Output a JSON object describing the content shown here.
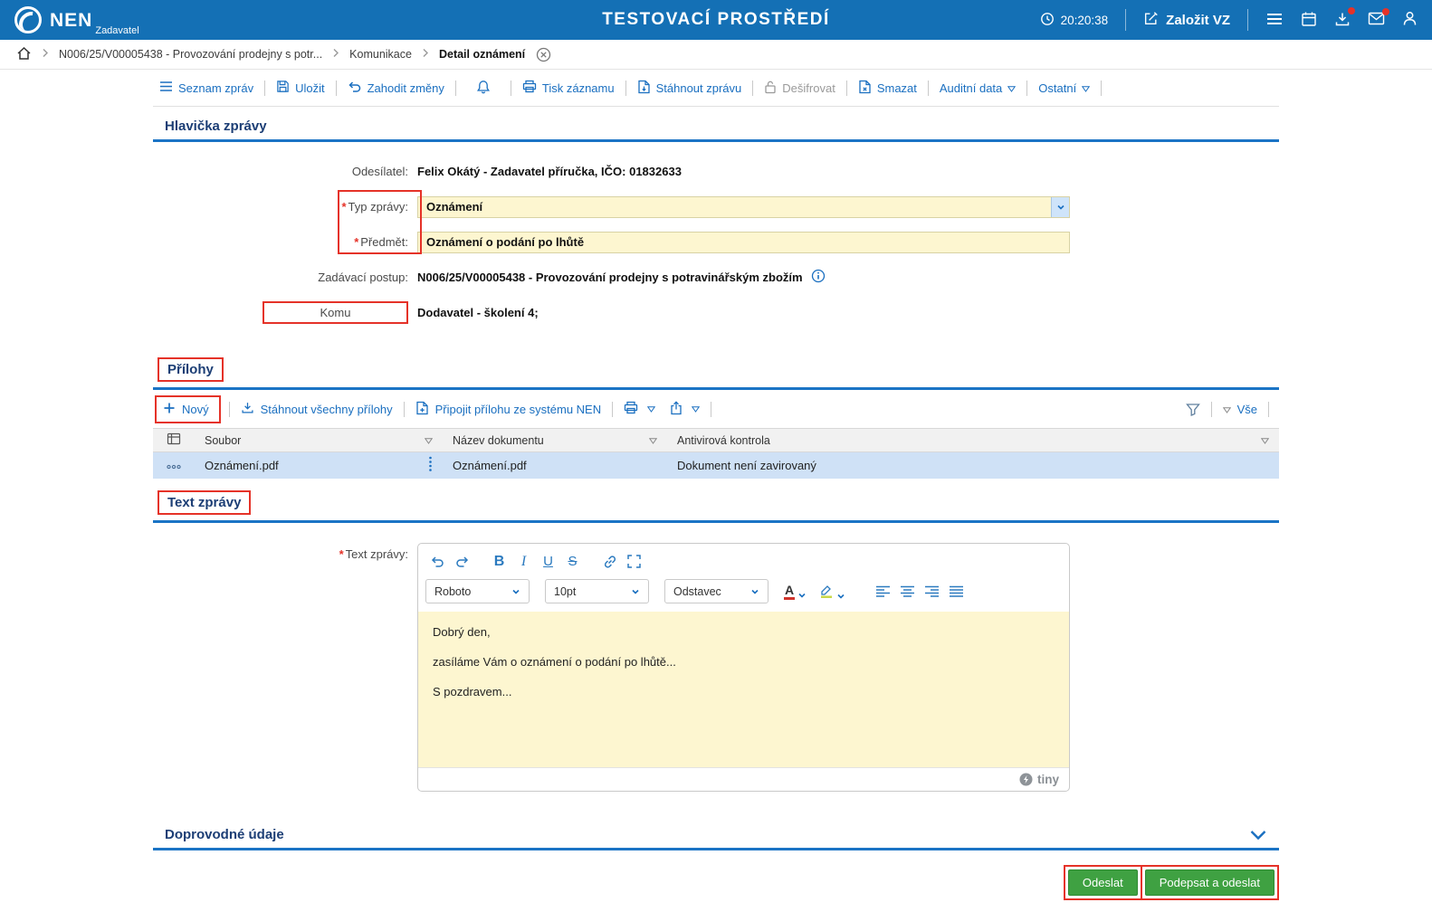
{
  "colors": {
    "header_blue": "#1470b5",
    "link_blue": "#1a6fc0",
    "section_navy": "#1c3e75",
    "underline_blue": "#1b74c5",
    "input_yellow": "#fdf6d0",
    "selected_row_blue": "#cfe1f6",
    "button_green": "#3fa142",
    "annotation_red": "#e53228"
  },
  "ui": {
    "required_mark": "*"
  },
  "header": {
    "brand": "NEN",
    "brand_sub": "Zadavatel",
    "env_title": "TESTOVACÍ PROSTŘEDÍ",
    "time": "20:20:38",
    "create_vz": "Založit VZ"
  },
  "breadcrumb": {
    "items": [
      "N006/25/V00005438 - Provozování prodejny s potr...",
      "Komunikace",
      "Detail oznámení"
    ]
  },
  "toolbar": {
    "seznam": "Seznam zpráv",
    "ulozit": "Uložit",
    "zahodit": "Zahodit změny",
    "tisk": "Tisk záznamu",
    "stahnout": "Stáhnout zprávu",
    "desifrovat": "Dešifrovat",
    "smazat": "Smazat",
    "auditni": "Auditní data",
    "ostatni": "Ostatní"
  },
  "message_header": {
    "title": "Hlavička zprávy",
    "sender_label": "Odesílatel:",
    "sender_value": "Felix Okátý - Zadavatel příručka, IČO: 01832633",
    "type_label": "Typ zprávy:",
    "type_value": "Oznámení",
    "subject_label": "Předmět:",
    "subject_value": "Oznámení o podání po lhůtě",
    "procedure_label": "Zadávací postup:",
    "procedure_value": "N006/25/V00005438 - Provozování prodejny s potravinářským zbožím",
    "to_label": "Komu",
    "to_value": "Dodavatel - školení 4;"
  },
  "attachments": {
    "title": "Přílohy",
    "new": "Nový",
    "download_all": "Stáhnout všechny přílohy",
    "attach_nen": "Připojit přílohu ze systému NEN",
    "all_filter": "Vše",
    "columns": [
      "Soubor",
      "Název dokumentu",
      "Antivirová kontrola"
    ],
    "rows": [
      {
        "soubor": "Oznámení.pdf",
        "nazev": "Oznámení.pdf",
        "antivir": "Dokument není zavirovaný"
      }
    ]
  },
  "message_text": {
    "title": "Text zprávy",
    "field_label": "Text zprávy:",
    "editor": {
      "font": "Roboto",
      "size": "10pt",
      "block": "Odstavec",
      "lines": [
        "Dobrý den,",
        "zasíláme Vám o oznámení o podání po lhůtě...",
        "S pozdravem..."
      ],
      "brand": "tiny"
    }
  },
  "additional_section": {
    "title": "Doprovodné údaje"
  },
  "actions": {
    "send": "Odeslat",
    "sign_and_send": "Podepsat a odeslat"
  }
}
